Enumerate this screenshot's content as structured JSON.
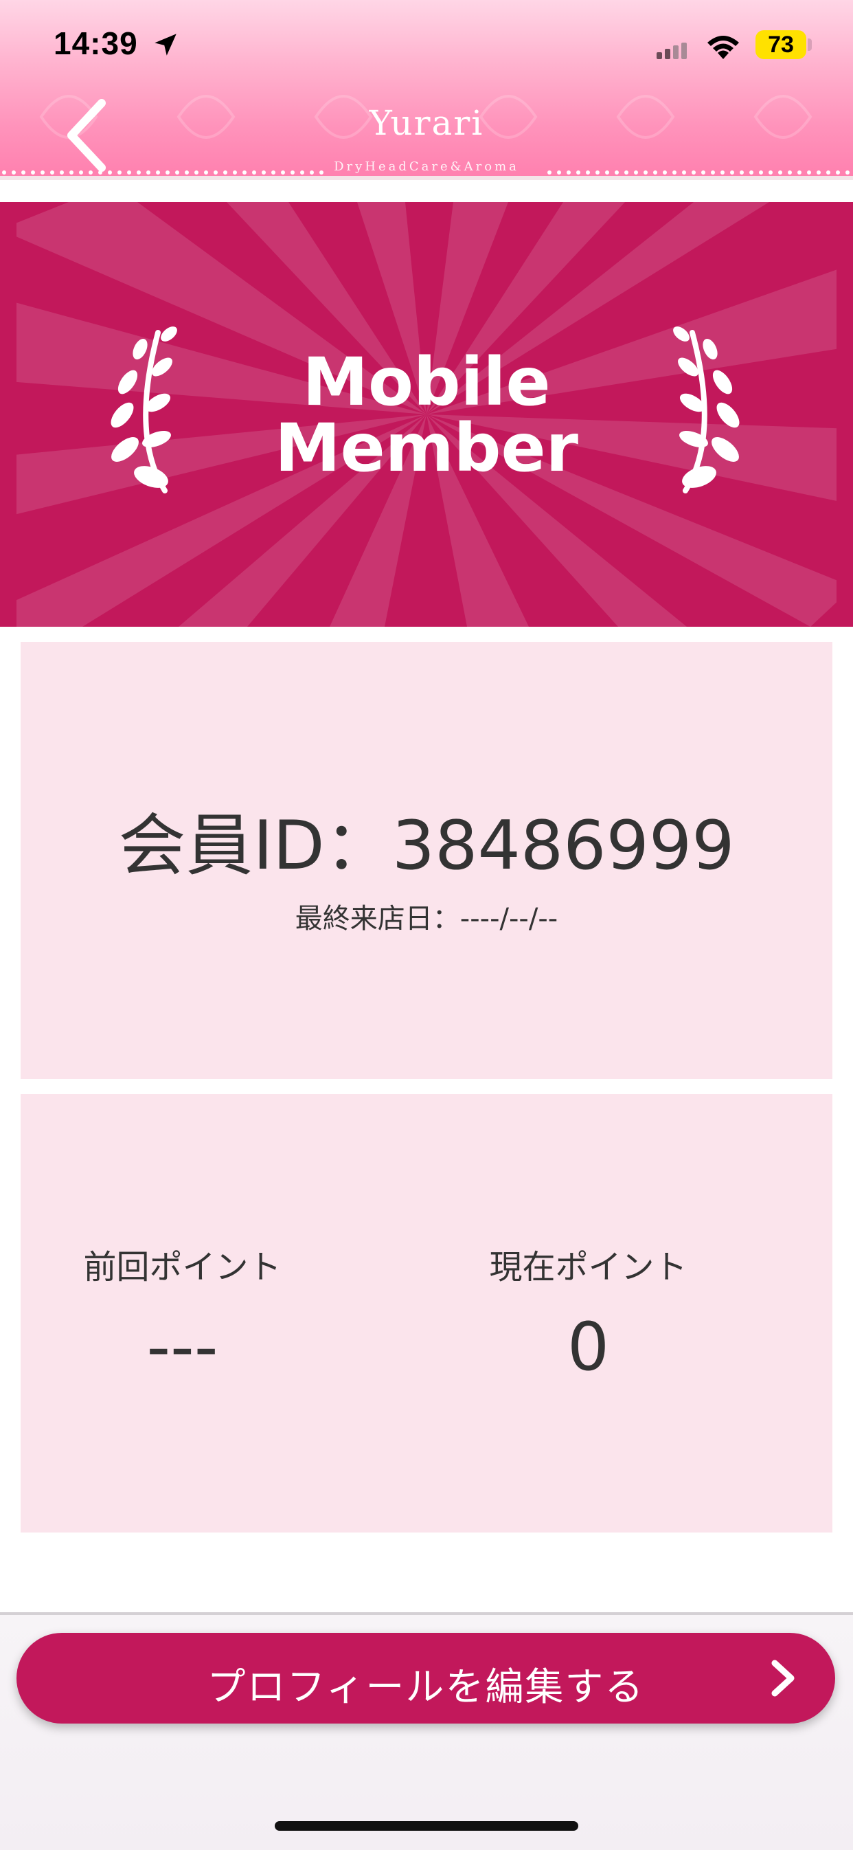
{
  "status_bar": {
    "time": "14:39",
    "battery": "73"
  },
  "header": {
    "title": "Yurari",
    "subtitle": "DryHeadCare&Aroma",
    "accent": "#ff8ab5"
  },
  "banner": {
    "line1": "Mobile",
    "line2": "Member",
    "color": "#c2185b"
  },
  "member": {
    "id_text": "会員ID：38486999",
    "last_visit": "最終来店日：----/--/--"
  },
  "points": {
    "previous_label": "前回ポイント",
    "previous_value": "---",
    "current_label": "現在ポイント",
    "current_value": "0"
  },
  "actions": {
    "edit_profile": "プロフィールを編集する"
  },
  "icons": [
    "location-arrow-icon",
    "signal-icon",
    "wifi-icon",
    "battery-icon",
    "back-chevron-icon",
    "laurel-left-icon",
    "laurel-right-icon",
    "chevron-right-icon"
  ]
}
